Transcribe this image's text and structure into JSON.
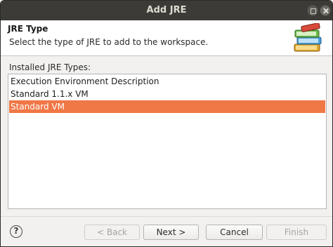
{
  "window": {
    "title": "Add JRE"
  },
  "header": {
    "title": "JRE Type",
    "description": "Select the type of JRE to add to the workspace."
  },
  "list": {
    "label": "Installed JRE Types:",
    "items": [
      {
        "label": "Execution Environment Description",
        "selected": false
      },
      {
        "label": "Standard 1.1.x VM",
        "selected": false
      },
      {
        "label": "Standard VM",
        "selected": true
      }
    ]
  },
  "footer": {
    "help_label": "?",
    "back_label": "< Back",
    "next_label": "Next >",
    "cancel_label": "Cancel",
    "finish_label": "Finish"
  },
  "colors": {
    "selection": "#f07746",
    "titlebar": "#3c3b37"
  },
  "icons": {
    "banner": "books-icon",
    "help": "help-icon"
  }
}
